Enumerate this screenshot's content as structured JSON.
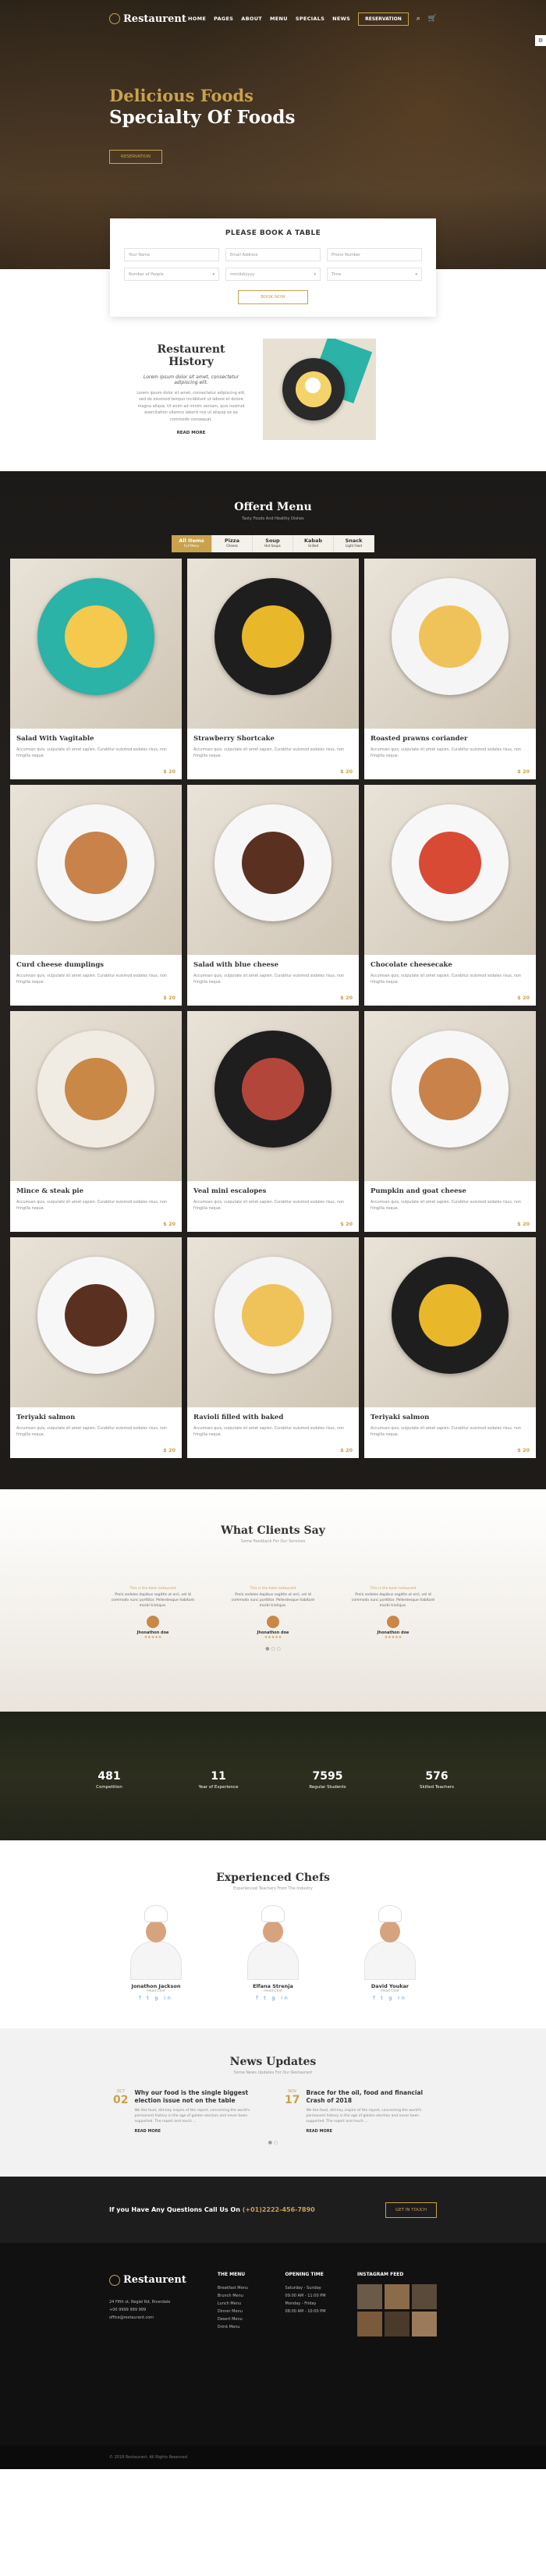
{
  "nav": {
    "logo": "Restaurent",
    "items": [
      "HOME",
      "PAGES",
      "ABOUT",
      "MENU",
      "SPECIALS",
      "NEWS"
    ],
    "reservation": "RESERVATION",
    "cart_count": "0"
  },
  "hero": {
    "line1": "Delicious Foods",
    "line2": "Specialty Of Foods",
    "button": "RESERVATION"
  },
  "booking": {
    "title": "PLEASE BOOK A TABLE",
    "name_ph": "Your Name",
    "email_ph": "Email Address",
    "phone_ph": "Phone Number",
    "people": "Number of People",
    "date": "mm/dd/yyyy",
    "time": "Time",
    "button": "BOOK NOW"
  },
  "history": {
    "title": "Restaurent History",
    "lead": "Lorem ipsum dolor sit amet, consectetur adipiscing elit.",
    "body": "Lorem ipsum dolor sit amet, consectetur adipiscing elit, sed do eiusmod tempor incididunt ut labore et dolore magna aliqua. Ut enim ad minim veniam, quis nostrud exercitation ullamco laboris nisi ut aliquip ex ea commodo consequat.",
    "more": "READ MORE"
  },
  "menu": {
    "title": "Offerd Menu",
    "sub": "Tasty Foods And Healthy Dishes",
    "tabs": [
      {
        "label": "All Items",
        "sub": "Full Menu"
      },
      {
        "label": "Pizza",
        "sub": "Cheese"
      },
      {
        "label": "Soup",
        "sub": "Hot Soups"
      },
      {
        "label": "Kabab",
        "sub": "Grilled"
      },
      {
        "label": "Snack",
        "sub": "Light Food"
      }
    ],
    "items": [
      {
        "name": "Salad With Vagitable",
        "desc": "Accumsan quis, vulputate sit amet sapien. Curabitur euismod sodales risus, non fringilla neque.",
        "price": "$ 20"
      },
      {
        "name": "Strawberry Shortcake",
        "desc": "Accumsan quis, vulputate sit amet sapien. Curabitur euismod sodales risus, non fringilla neque.",
        "price": "$ 20"
      },
      {
        "name": "Roasted prawns coriander",
        "desc": "Accumsan quis, vulputate sit amet sapien. Curabitur euismod sodales risus, non fringilla neque.",
        "price": "$ 20"
      },
      {
        "name": "Curd cheese dumplings",
        "desc": "Accumsan quis, vulputate sit amet sapien. Curabitur euismod sodales risus, non fringilla neque.",
        "price": "$ 20"
      },
      {
        "name": "Salad with blue cheese",
        "desc": "Accumsan quis, vulputate sit amet sapien. Curabitur euismod sodales risus, non fringilla neque.",
        "price": "$ 20"
      },
      {
        "name": "Chocolate cheesecake",
        "desc": "Accumsan quis, vulputate sit amet sapien. Curabitur euismod sodales risus, non fringilla neque.",
        "price": "$ 20"
      },
      {
        "name": "Mince & steak pie",
        "desc": "Accumsan quis, vulputate sit amet sapien. Curabitur euismod sodales risus, non fringilla neque.",
        "price": "$ 20"
      },
      {
        "name": "Veal mini escalopes",
        "desc": "Accumsan quis, vulputate sit amet sapien. Curabitur euismod sodales risus, non fringilla neque.",
        "price": "$ 20"
      },
      {
        "name": "Pumpkin and goat cheese",
        "desc": "Accumsan quis, vulputate sit amet sapien. Curabitur euismod sodales risus, non fringilla neque.",
        "price": "$ 20"
      },
      {
        "name": "Teriyaki salmon",
        "desc": "Accumsan quis, vulputate sit amet sapien. Curabitur euismod sodales risus, non fringilla neque.",
        "price": "$ 20"
      },
      {
        "name": "Ravioli filled with baked",
        "desc": "Accumsan quis, vulputate sit amet sapien. Curabitur euismod sodales risus, non fringilla neque.",
        "price": "$ 20"
      },
      {
        "name": "Teriyaki salmon",
        "desc": "Accumsan quis, vulputate sit amet sapien. Curabitur euismod sodales risus, non fringilla neque.",
        "price": "$ 20"
      }
    ]
  },
  "clients": {
    "title": "What Clients Say",
    "sub": "Some Feedback For Our Services",
    "items": [
      {
        "quote": "This is the best restaurant",
        "text": "Proin sodales dapibus sagittis ut orci, vel id commodo nunc porttitor. Pellentesque habitant morbi tristique.",
        "name": "Jhonathon doe"
      },
      {
        "quote": "This is the best restaurant",
        "text": "Proin sodales dapibus sagittis ut orci, vel id commodo nunc porttitor. Pellentesque habitant morbi tristique.",
        "name": "Jhonathon doe"
      },
      {
        "quote": "This is the best restaurant",
        "text": "Proin sodales dapibus sagittis ut orci, vel id commodo nunc porttitor. Pellentesque habitant morbi tristique.",
        "name": "Jhonathon doe"
      }
    ]
  },
  "stats": [
    {
      "n": "481",
      "l": "Competition"
    },
    {
      "n": "11",
      "l": "Year of Experience"
    },
    {
      "n": "7595",
      "l": "Regular Students"
    },
    {
      "n": "576",
      "l": "Skilled Teachers"
    }
  ],
  "chefs": {
    "title": "Experienced Chefs",
    "sub": "Experienced Teachers From The Industry",
    "items": [
      {
        "name": "Jonathon Jackson",
        "role": "Head Chef"
      },
      {
        "name": "Elfana Strenja",
        "role": "Head Chef"
      },
      {
        "name": "David Youkar",
        "role": "Head Chef"
      }
    ]
  },
  "news": {
    "title": "News Updates",
    "sub": "Some News Updates For Our Restaurant",
    "items": [
      {
        "month": "OCT",
        "day": "02",
        "title": "Why our food is the single biggest election issue not on the table",
        "text": "We like food, dirt-key inspire of the report, concerning the world's permanent history in the age of golden election and never been supported. The report and much ...",
        "more": "READ MORE"
      },
      {
        "month": "NOV",
        "day": "17",
        "title": "Brace for the oil, food and financial Crash of 2018",
        "text": "We like food, dirt-key inspire of the report, concerning the world's permanent history in the age of golden election and never been supported. The report and much ...",
        "more": "READ MORE"
      }
    ]
  },
  "cta": {
    "text": "If you Have Any Questions Call Us On",
    "phone": "(+01)2222-456-7890",
    "button": "GET IN TOUCH"
  },
  "footer": {
    "logo": "Restaurent",
    "address": "24 Fifth st, Regiel Rd, Riverdale",
    "phone": "+00 9999 999 999",
    "email": "office@restaurant.com",
    "menu_title": "THE MENU",
    "menu_items": [
      "Breakfast Menu",
      "Brunch Menu",
      "Lunch Menu",
      "Dinner Menu",
      "Desert Menu",
      "Drink Menu"
    ],
    "hours_title": "OPENING TIME",
    "hours": [
      "Saturday - Sunday",
      "09:00 AM - 11:00 PM",
      "Monday - Friday",
      "08:00 AM - 10:00 PM"
    ],
    "insta_title": "INSTAGRAM FEED",
    "copy": "© 2018 Restaurant. All Rights Reserved."
  }
}
